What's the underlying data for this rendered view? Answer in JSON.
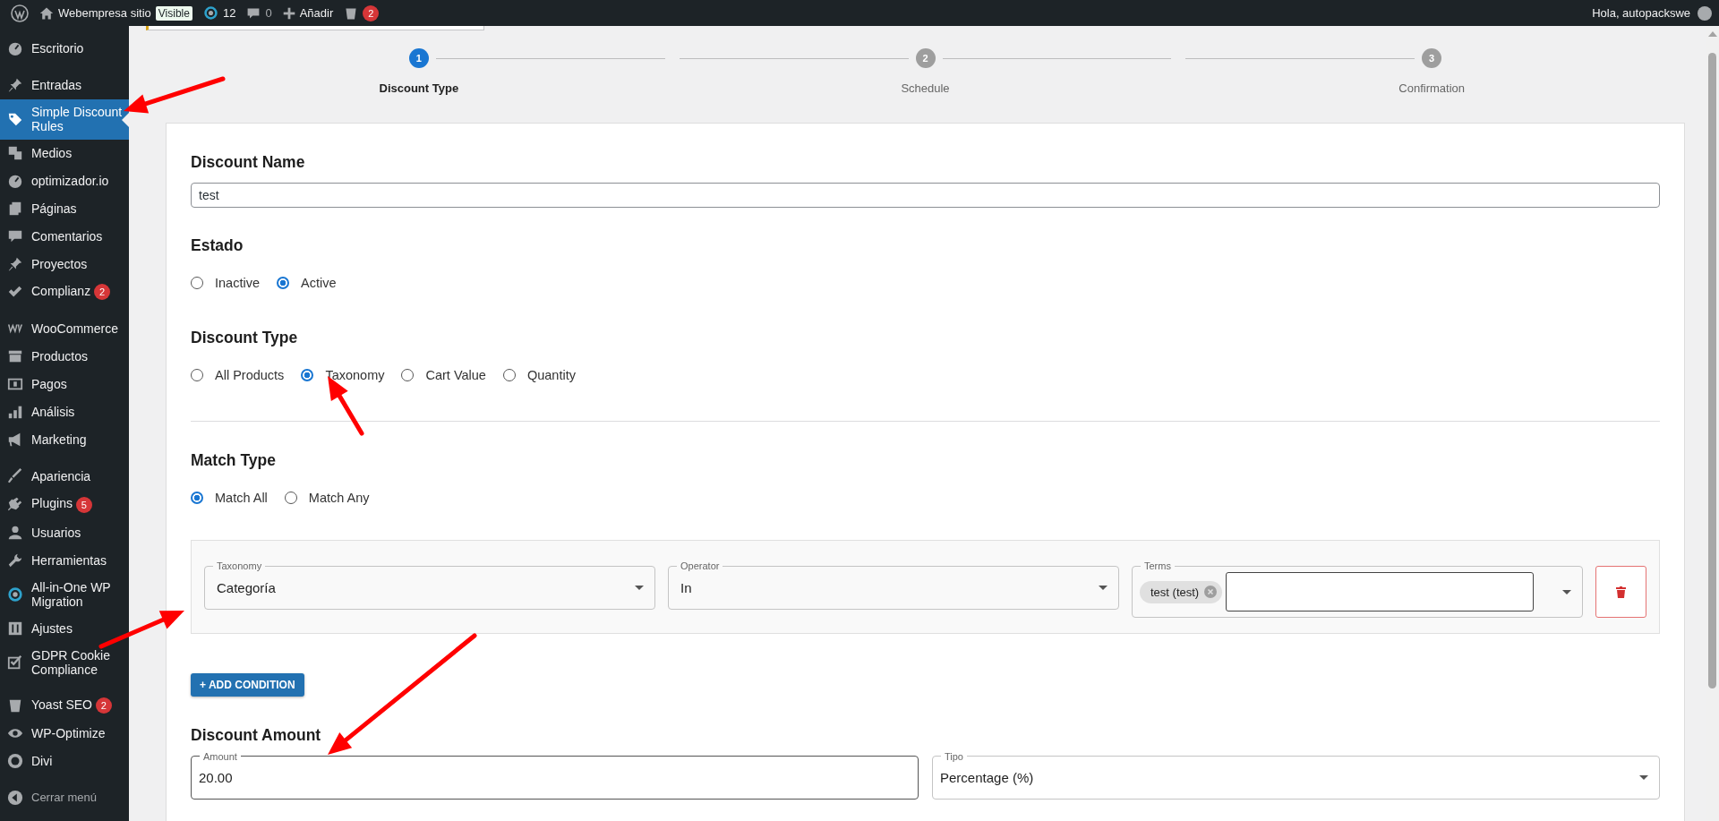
{
  "admin_bar": {
    "site_name": "Webempresa sitio",
    "visibility_badge": "Visible",
    "updates_count": "12",
    "comments_count": "0",
    "new_label": "Añadir",
    "yoast_badge": "2",
    "greeting": "Hola, autopackswe"
  },
  "sidebar": {
    "sections": [
      {
        "items": [
          {
            "label": "Escritorio",
            "selected": false
          }
        ]
      },
      {
        "items": [
          {
            "label": "Entradas",
            "selected": false
          },
          {
            "label": "Simple Discount Rules",
            "selected": true
          },
          {
            "label": "Medios",
            "selected": false
          },
          {
            "label": "optimizador.io",
            "selected": false
          },
          {
            "label": "Páginas",
            "selected": false
          },
          {
            "label": "Comentarios",
            "selected": false
          },
          {
            "label": "Proyectos",
            "selected": false
          },
          {
            "label": "Complianz",
            "selected": false,
            "badge": "2"
          }
        ]
      },
      {
        "items": [
          {
            "label": "WooCommerce",
            "selected": false
          },
          {
            "label": "Productos",
            "selected": false
          },
          {
            "label": "Pagos",
            "selected": false
          },
          {
            "label": "Análisis",
            "selected": false
          },
          {
            "label": "Marketing",
            "selected": false
          }
        ]
      },
      {
        "items": [
          {
            "label": "Apariencia",
            "selected": false
          },
          {
            "label": "Plugins",
            "selected": false,
            "badge": "5"
          },
          {
            "label": "Usuarios",
            "selected": false
          },
          {
            "label": "Herramientas",
            "selected": false
          },
          {
            "label": "All-in-One WP Migration",
            "selected": false
          },
          {
            "label": "Ajustes",
            "selected": false
          },
          {
            "label": "GDPR Cookie Compliance",
            "selected": false
          }
        ]
      },
      {
        "items": [
          {
            "label": "Yoast SEO",
            "selected": false,
            "badge": "2"
          },
          {
            "label": "WP-Optimize",
            "selected": false
          },
          {
            "label": "Divi",
            "selected": false
          }
        ]
      }
    ],
    "collapse_label": "Cerrar menú"
  },
  "stepper": {
    "steps": [
      {
        "number": "1",
        "label": "Discount Type",
        "selected": true
      },
      {
        "number": "2",
        "label": "Schedule",
        "selected": false
      },
      {
        "number": "3",
        "label": "Confirmation",
        "selected": false
      }
    ]
  },
  "discount_name": {
    "label": "Discount Name",
    "value": "test"
  },
  "estado": {
    "label": "Estado",
    "options": [
      {
        "label": "Inactive",
        "selected": false
      },
      {
        "label": "Active",
        "selected": true
      }
    ]
  },
  "discount_type": {
    "label": "Discount Type",
    "options": [
      {
        "label": "All Products",
        "selected": false
      },
      {
        "label": "Taxonomy",
        "selected": true
      },
      {
        "label": "Cart Value",
        "selected": false
      },
      {
        "label": "Quantity",
        "selected": false
      }
    ]
  },
  "match_type": {
    "label": "Match Type",
    "options": [
      {
        "label": "Match All",
        "selected": true
      },
      {
        "label": "Match Any",
        "selected": false
      }
    ]
  },
  "conditions": [
    {
      "taxonomy": {
        "label": "Taxonomy",
        "value": "Categoría"
      },
      "operator": {
        "label": "Operator",
        "value": "In"
      },
      "terms": {
        "label": "Terms",
        "chips": [
          "test (test)"
        ]
      }
    }
  ],
  "add_condition_button": "+ ADD CONDITION",
  "discount_amount": {
    "label": "Discount Amount",
    "amount": {
      "label": "Amount",
      "value": "20.00"
    },
    "type": {
      "label": "Tipo",
      "value": "Percentage (%)"
    }
  }
}
